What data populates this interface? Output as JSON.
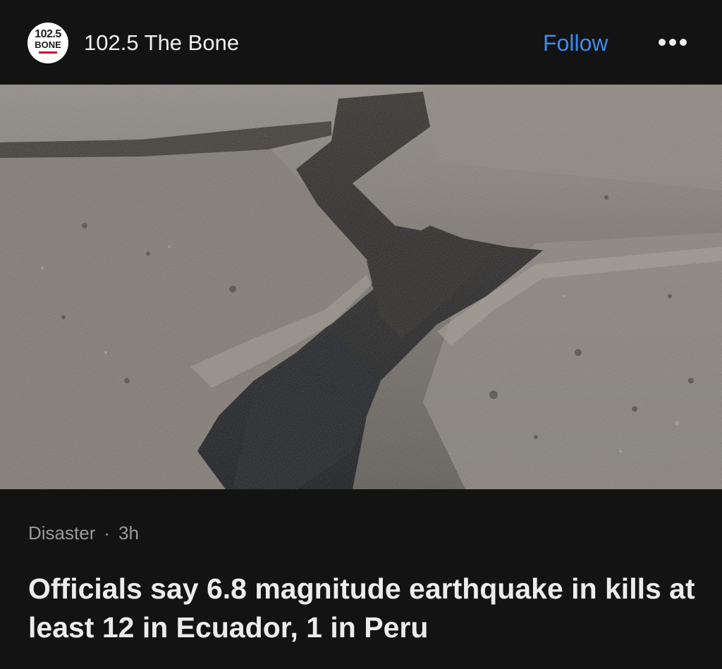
{
  "header": {
    "logo_top": "102.5",
    "logo_bottom": "BONE",
    "source_name": "102.5 The Bone",
    "follow_label": "Follow",
    "more_icon": "more-horizontal-icon"
  },
  "article": {
    "category": "Disaster",
    "separator": "·",
    "age": "3h",
    "headline": "Officials say 6.8 magnitude earthquake in kills at least 12 in Ecuador, 1 in Peru"
  },
  "colors": {
    "background": "#131313",
    "follow": "#3b8cf0",
    "meta": "#9a9a9a",
    "headline": "#ececec"
  }
}
